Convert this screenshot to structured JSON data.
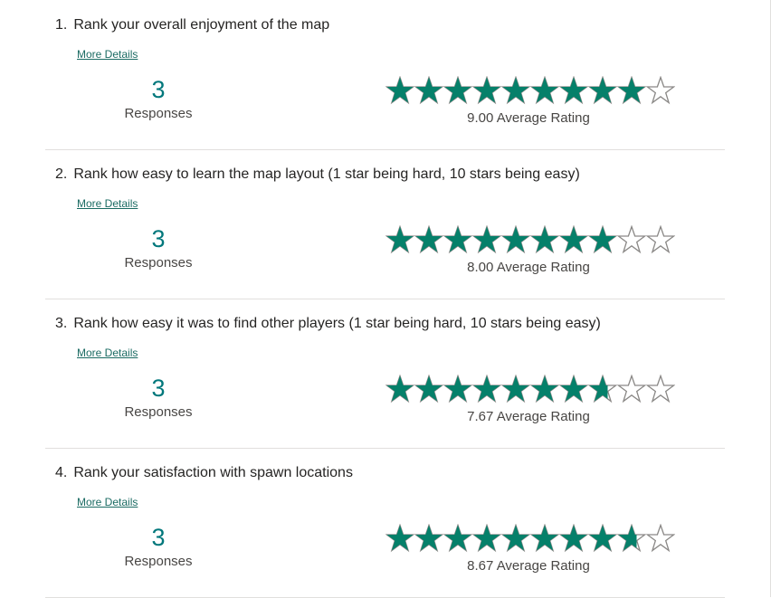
{
  "questions": [
    {
      "number": "1.",
      "title": "Rank your overall enjoyment of the map",
      "more_details": "More Details",
      "responses_count": "3",
      "responses_label": "Responses",
      "average_rating": 9.0,
      "average_label": "9.00 Average Rating"
    },
    {
      "number": "2.",
      "title": "Rank how easy to learn the map layout (1 star being hard, 10 stars being easy)",
      "more_details": "More Details",
      "responses_count": "3",
      "responses_label": "Responses",
      "average_rating": 8.0,
      "average_label": "8.00 Average Rating"
    },
    {
      "number": "3.",
      "title": "Rank how easy it was to find other players (1 star being hard, 10 stars being easy)",
      "more_details": "More Details",
      "responses_count": "3",
      "responses_label": "Responses",
      "average_rating": 7.67,
      "average_label": "7.67 Average Rating"
    },
    {
      "number": "4.",
      "title": "Rank your satisfaction with spawn locations",
      "more_details": "More Details",
      "responses_count": "3",
      "responses_label": "Responses",
      "average_rating": 8.67,
      "average_label": "8.67 Average Rating"
    }
  ],
  "max_stars": 10,
  "colors": {
    "star_filled": "#05806a",
    "star_empty_stroke": "#8a8886",
    "accent": "#03787c"
  }
}
